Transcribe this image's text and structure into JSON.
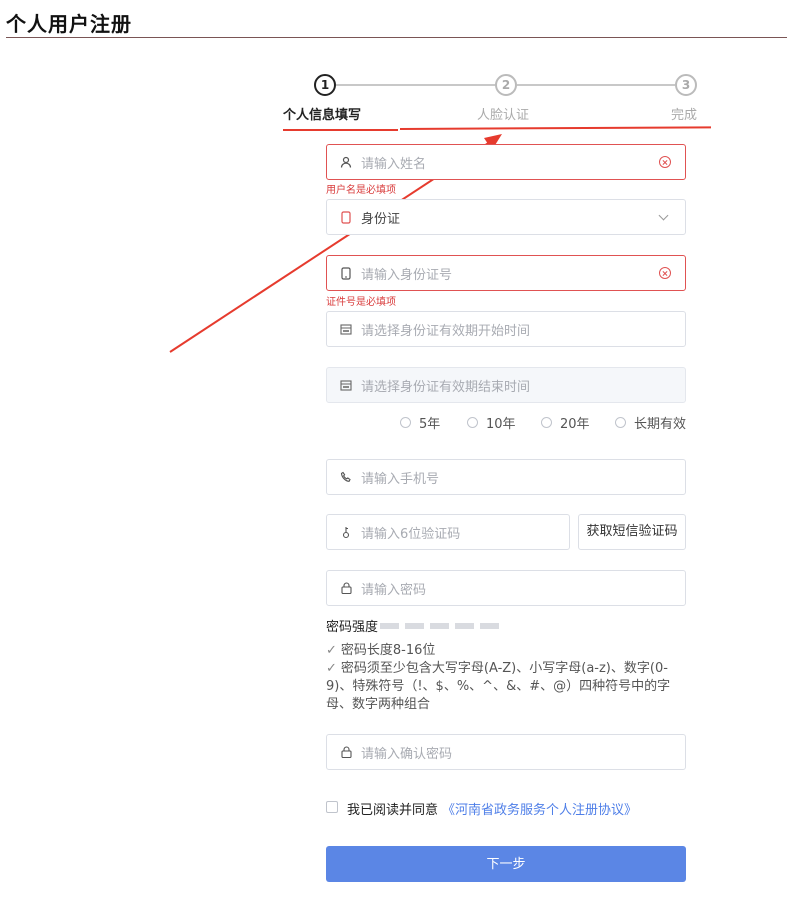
{
  "page": {
    "title": "个人用户注册"
  },
  "steps": [
    {
      "number": "1",
      "label": "个人信息填写",
      "active": true
    },
    {
      "number": "2",
      "label": "人脸认证",
      "active": false
    },
    {
      "number": "3",
      "label": "完成",
      "active": false
    }
  ],
  "form": {
    "name": {
      "placeholder": "请输入姓名",
      "icon": "user-icon",
      "error": "用户名是必填项"
    },
    "id_type": {
      "value": "身份证",
      "icon": "id-card-icon"
    },
    "id_number": {
      "placeholder": "请输入身份证号",
      "icon": "phone-card-icon",
      "error": "证件号是必填项"
    },
    "id_start": {
      "placeholder": "请选择身份证有效期开始时间",
      "icon": "calendar-icon"
    },
    "id_end": {
      "placeholder": "请选择身份证有效期结束时间",
      "icon": "calendar-icon"
    },
    "validity_options": [
      "5年",
      "10年",
      "20年",
      "长期有效"
    ],
    "phone": {
      "placeholder": "请输入手机号",
      "icon": "phone-icon"
    },
    "sms_code": {
      "placeholder": "请输入6位验证码",
      "icon": "key-icon",
      "button": "获取短信验证码"
    },
    "password": {
      "placeholder": "请输入密码",
      "icon": "lock-icon"
    },
    "password_strength": {
      "label": "密码强度",
      "bars": 5
    },
    "password_rules": [
      "密码长度8-16位",
      "密码须至少包含大写字母(A-Z)、小写字母(a-z)、数字(0-9)、特殊符号（!、$、%、^、&、#、@）四种符号中的字母、数字两种组合"
    ],
    "confirm_password": {
      "placeholder": "请输入确认密码",
      "icon": "lock-icon"
    },
    "agreement": {
      "text": "我已阅读并同意",
      "link": "《河南省政务服务个人注册协议》"
    },
    "next_button": "下一步"
  },
  "colors": {
    "accent": "#5b86e5",
    "error": "#e05252",
    "annotation": "#e63b2e",
    "link": "#4f7fe8"
  }
}
